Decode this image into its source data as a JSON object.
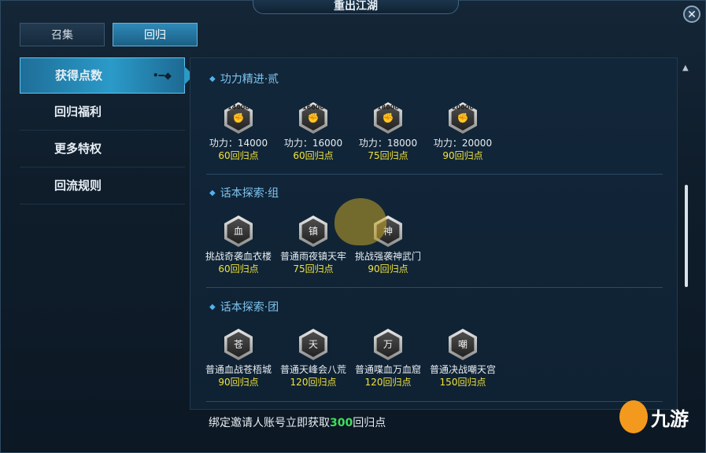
{
  "window": {
    "title": "重出江湖",
    "close_label": "✕"
  },
  "tabs": [
    {
      "label": "召集",
      "active": false
    },
    {
      "label": "回归",
      "active": true
    }
  ],
  "sidebar": {
    "items": [
      {
        "label": "获得点数",
        "active": true
      },
      {
        "label": "回归福利",
        "active": false
      },
      {
        "label": "更多特权",
        "active": false
      },
      {
        "label": "回流规则",
        "active": false
      }
    ],
    "active_decoration": "•━◆"
  },
  "sections": [
    {
      "title": "功力精进·贰",
      "items": [
        {
          "badge": "14000",
          "icon": "fist-icon",
          "name": "功力：14000",
          "points": "60回归点"
        },
        {
          "badge": "16000",
          "icon": "fist-icon",
          "name": "功力：16000",
          "points": "60回归点"
        },
        {
          "badge": "18000",
          "icon": "fist-icon",
          "name": "功力：18000",
          "points": "75回归点"
        },
        {
          "badge": "20000",
          "icon": "fist-icon",
          "name": "功力：20000",
          "points": "90回归点"
        }
      ]
    },
    {
      "title": "话本探索·组",
      "items": [
        {
          "badge": "血",
          "icon": "pagoda-icon",
          "name": "挑战奇袭血衣楼",
          "points": "60回归点"
        },
        {
          "badge": "镇",
          "icon": "pagoda-icon",
          "name": "普通雨夜镇天牢",
          "points": "75回归点"
        },
        {
          "badge": "神",
          "icon": "pagoda-icon",
          "name": "挑战强袭神武门",
          "points": "90回归点"
        }
      ]
    },
    {
      "title": "话本探索·团",
      "items": [
        {
          "badge": "苍",
          "icon": "pagoda-icon",
          "name": "普通血战苍梧城",
          "points": "90回归点"
        },
        {
          "badge": "天",
          "icon": "pagoda-icon",
          "name": "普通天峰会八荒",
          "points": "120回归点"
        },
        {
          "badge": "万",
          "icon": "pagoda-icon",
          "name": "普通喋血万血窟",
          "points": "120回归点"
        },
        {
          "badge": "嘲",
          "icon": "pagoda-icon",
          "name": "普通决战嘲天宫",
          "points": "150回归点"
        }
      ]
    }
  ],
  "footer": {
    "prefix": "绑定邀请人账号立即获取",
    "highlight": "300",
    "suffix": "回归点"
  },
  "watermark": {
    "text": "九游"
  },
  "colors": {
    "accent": "#2b9ac8",
    "points": "#f2e33a",
    "highlight": "#3ee05a",
    "section_title": "#7ec4ee"
  }
}
